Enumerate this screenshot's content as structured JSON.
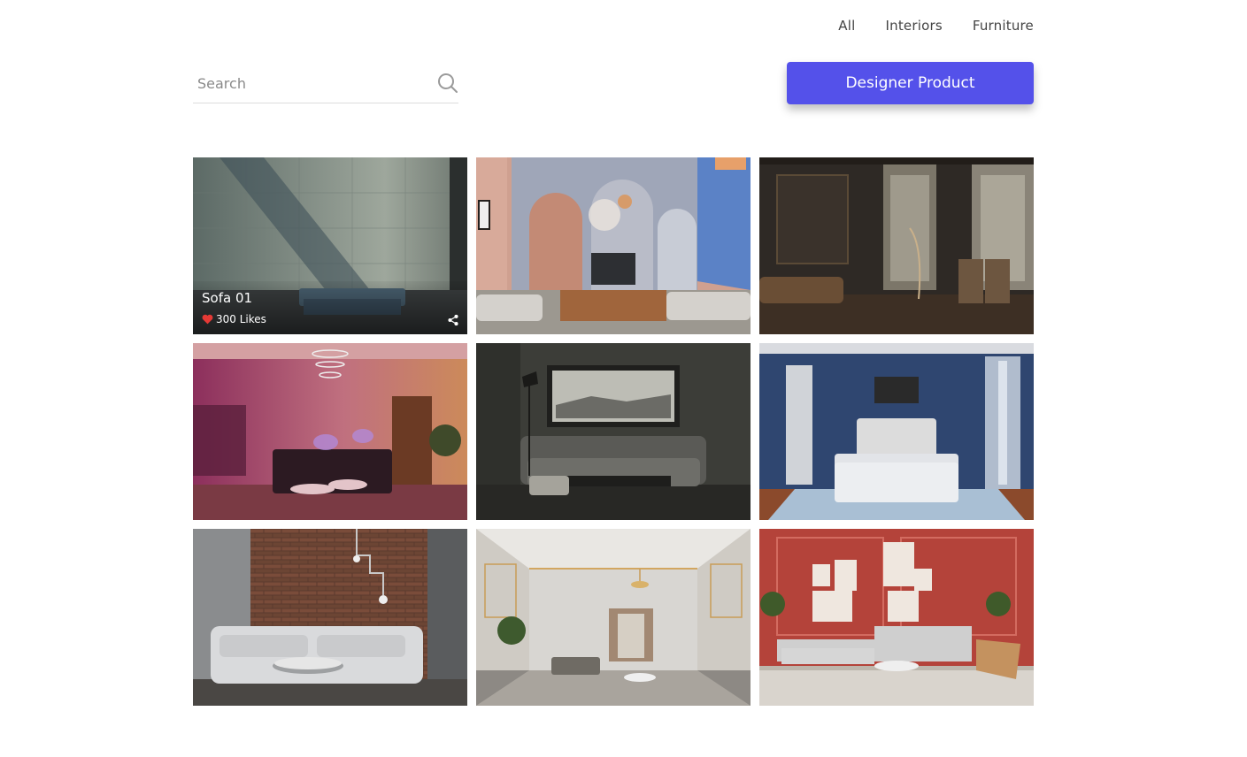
{
  "nav": {
    "items": [
      {
        "label": "All"
      },
      {
        "label": "Interiors"
      },
      {
        "label": "Furniture"
      }
    ]
  },
  "search": {
    "placeholder": "Search",
    "value": "",
    "icon": "search-icon"
  },
  "cta": {
    "label": "Designer Product",
    "color": "#5451ea"
  },
  "featured": {
    "title": "Sofa 01",
    "likes": "300 Likes",
    "like_icon": "heart-icon",
    "share_icon": "share-icon",
    "heart_color": "#e53935"
  }
}
